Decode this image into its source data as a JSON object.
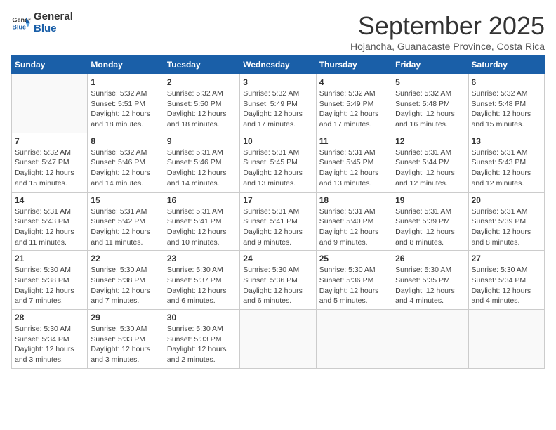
{
  "logo": {
    "line1": "General",
    "line2": "Blue"
  },
  "title": "September 2025",
  "subtitle": "Hojancha, Guanacaste Province, Costa Rica",
  "weekdays": [
    "Sunday",
    "Monday",
    "Tuesday",
    "Wednesday",
    "Thursday",
    "Friday",
    "Saturday"
  ],
  "weeks": [
    [
      {
        "day": "",
        "text": ""
      },
      {
        "day": "1",
        "text": "Sunrise: 5:32 AM\nSunset: 5:51 PM\nDaylight: 12 hours\nand 18 minutes."
      },
      {
        "day": "2",
        "text": "Sunrise: 5:32 AM\nSunset: 5:50 PM\nDaylight: 12 hours\nand 18 minutes."
      },
      {
        "day": "3",
        "text": "Sunrise: 5:32 AM\nSunset: 5:49 PM\nDaylight: 12 hours\nand 17 minutes."
      },
      {
        "day": "4",
        "text": "Sunrise: 5:32 AM\nSunset: 5:49 PM\nDaylight: 12 hours\nand 17 minutes."
      },
      {
        "day": "5",
        "text": "Sunrise: 5:32 AM\nSunset: 5:48 PM\nDaylight: 12 hours\nand 16 minutes."
      },
      {
        "day": "6",
        "text": "Sunrise: 5:32 AM\nSunset: 5:48 PM\nDaylight: 12 hours\nand 15 minutes."
      }
    ],
    [
      {
        "day": "7",
        "text": "Sunrise: 5:32 AM\nSunset: 5:47 PM\nDaylight: 12 hours\nand 15 minutes."
      },
      {
        "day": "8",
        "text": "Sunrise: 5:32 AM\nSunset: 5:46 PM\nDaylight: 12 hours\nand 14 minutes."
      },
      {
        "day": "9",
        "text": "Sunrise: 5:31 AM\nSunset: 5:46 PM\nDaylight: 12 hours\nand 14 minutes."
      },
      {
        "day": "10",
        "text": "Sunrise: 5:31 AM\nSunset: 5:45 PM\nDaylight: 12 hours\nand 13 minutes."
      },
      {
        "day": "11",
        "text": "Sunrise: 5:31 AM\nSunset: 5:45 PM\nDaylight: 12 hours\nand 13 minutes."
      },
      {
        "day": "12",
        "text": "Sunrise: 5:31 AM\nSunset: 5:44 PM\nDaylight: 12 hours\nand 12 minutes."
      },
      {
        "day": "13",
        "text": "Sunrise: 5:31 AM\nSunset: 5:43 PM\nDaylight: 12 hours\nand 12 minutes."
      }
    ],
    [
      {
        "day": "14",
        "text": "Sunrise: 5:31 AM\nSunset: 5:43 PM\nDaylight: 12 hours\nand 11 minutes."
      },
      {
        "day": "15",
        "text": "Sunrise: 5:31 AM\nSunset: 5:42 PM\nDaylight: 12 hours\nand 11 minutes."
      },
      {
        "day": "16",
        "text": "Sunrise: 5:31 AM\nSunset: 5:41 PM\nDaylight: 12 hours\nand 10 minutes."
      },
      {
        "day": "17",
        "text": "Sunrise: 5:31 AM\nSunset: 5:41 PM\nDaylight: 12 hours\nand 9 minutes."
      },
      {
        "day": "18",
        "text": "Sunrise: 5:31 AM\nSunset: 5:40 PM\nDaylight: 12 hours\nand 9 minutes."
      },
      {
        "day": "19",
        "text": "Sunrise: 5:31 AM\nSunset: 5:39 PM\nDaylight: 12 hours\nand 8 minutes."
      },
      {
        "day": "20",
        "text": "Sunrise: 5:31 AM\nSunset: 5:39 PM\nDaylight: 12 hours\nand 8 minutes."
      }
    ],
    [
      {
        "day": "21",
        "text": "Sunrise: 5:30 AM\nSunset: 5:38 PM\nDaylight: 12 hours\nand 7 minutes."
      },
      {
        "day": "22",
        "text": "Sunrise: 5:30 AM\nSunset: 5:38 PM\nDaylight: 12 hours\nand 7 minutes."
      },
      {
        "day": "23",
        "text": "Sunrise: 5:30 AM\nSunset: 5:37 PM\nDaylight: 12 hours\nand 6 minutes."
      },
      {
        "day": "24",
        "text": "Sunrise: 5:30 AM\nSunset: 5:36 PM\nDaylight: 12 hours\nand 6 minutes."
      },
      {
        "day": "25",
        "text": "Sunrise: 5:30 AM\nSunset: 5:36 PM\nDaylight: 12 hours\nand 5 minutes."
      },
      {
        "day": "26",
        "text": "Sunrise: 5:30 AM\nSunset: 5:35 PM\nDaylight: 12 hours\nand 4 minutes."
      },
      {
        "day": "27",
        "text": "Sunrise: 5:30 AM\nSunset: 5:34 PM\nDaylight: 12 hours\nand 4 minutes."
      }
    ],
    [
      {
        "day": "28",
        "text": "Sunrise: 5:30 AM\nSunset: 5:34 PM\nDaylight: 12 hours\nand 3 minutes."
      },
      {
        "day": "29",
        "text": "Sunrise: 5:30 AM\nSunset: 5:33 PM\nDaylight: 12 hours\nand 3 minutes."
      },
      {
        "day": "30",
        "text": "Sunrise: 5:30 AM\nSunset: 5:33 PM\nDaylight: 12 hours\nand 2 minutes."
      },
      {
        "day": "",
        "text": ""
      },
      {
        "day": "",
        "text": ""
      },
      {
        "day": "",
        "text": ""
      },
      {
        "day": "",
        "text": ""
      }
    ]
  ]
}
